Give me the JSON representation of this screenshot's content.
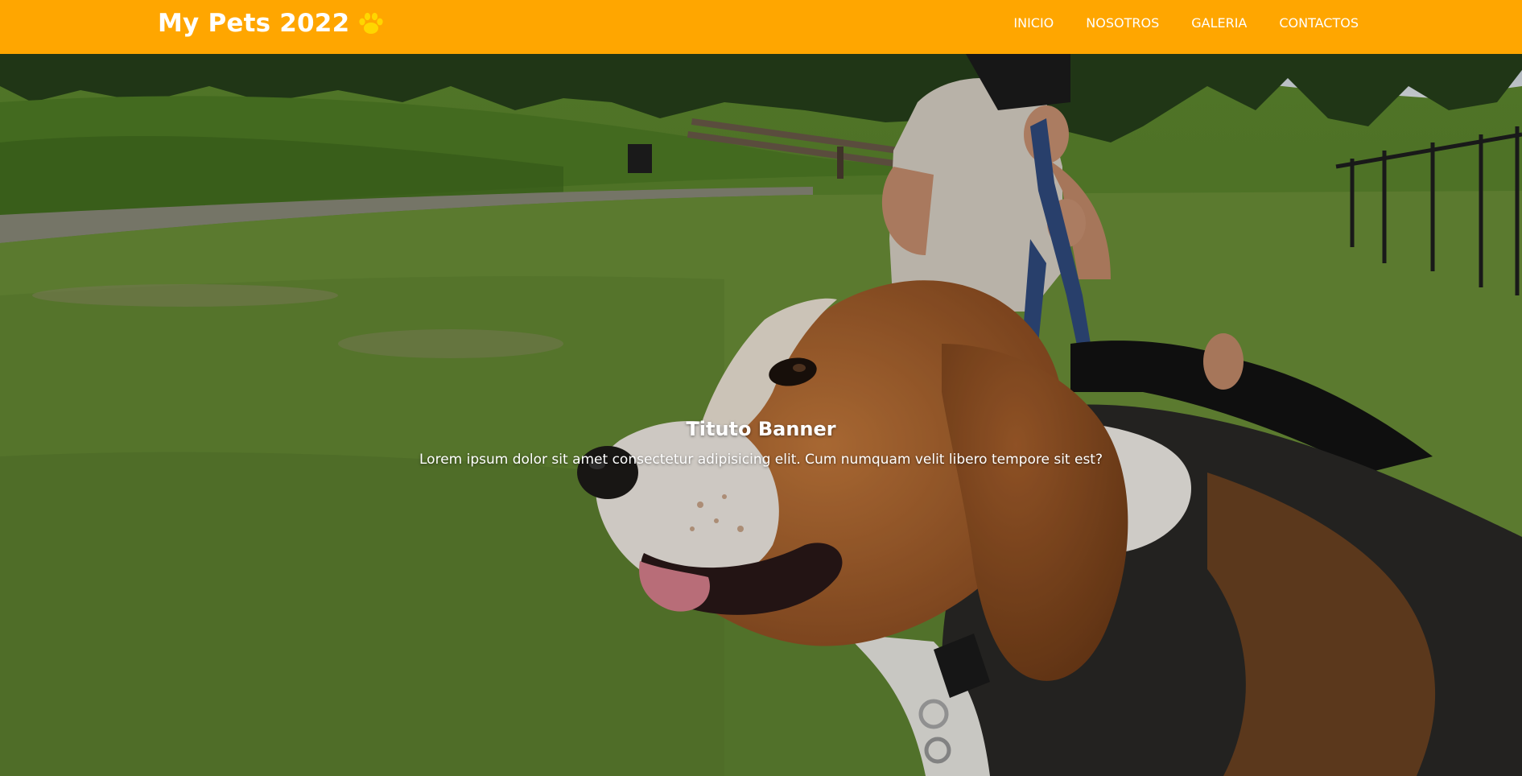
{
  "navbar": {
    "brand": "My Pets 2022",
    "brand_icon": "paw-icon",
    "background_color": "#ffa600",
    "links": [
      "INICIO",
      "NOSOTROS",
      "GALERIA",
      "CONTACTOS"
    ]
  },
  "hero": {
    "image": "beagle-in-park-photo",
    "title": "Tituto Banner",
    "subtitle": "Lorem ipsum dolor sit amet consectetur adipisicing elit. Cum numquam velit libero tempore sit est?"
  }
}
